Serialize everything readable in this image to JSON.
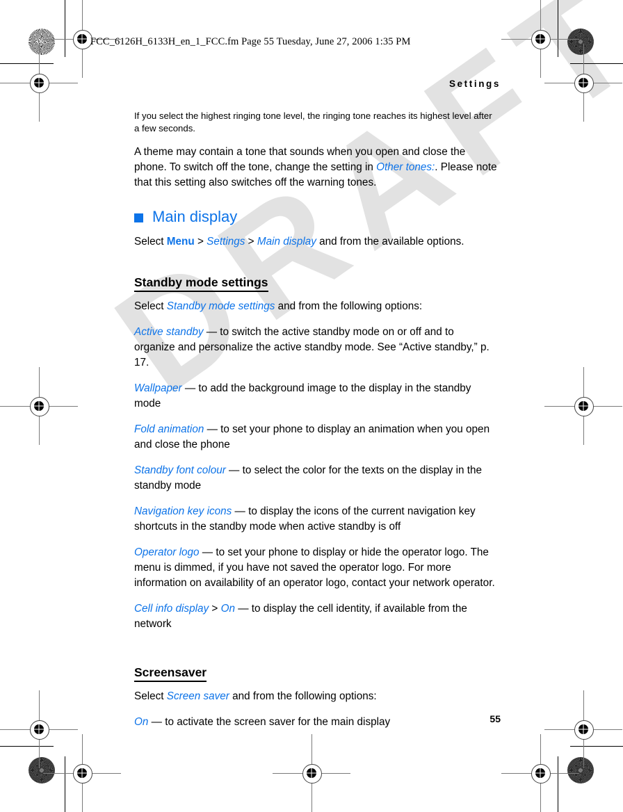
{
  "film_header": "FCC_6126H_6133H_en_1_FCC.fm  Page 55  Tuesday, June 27, 2006  1:35 PM",
  "running_head": "Settings",
  "watermark": "DRAFT",
  "folio": "55",
  "colors": {
    "accent_blue": "#0d73e8",
    "text_black": "#000000",
    "watermark_gray": "#e2e2e2",
    "page_background": "#ffffff"
  },
  "content": {
    "note": "If you select the highest ringing tone level, the ringing tone reaches its highest level after a few seconds.",
    "intro_para": {
      "before": "A theme may contain a tone that sounds when you open and close the phone. To switch off the tone, change the setting in ",
      "ui": "Other tones:",
      "after": ". Please note that this setting also switches off the warning tones."
    },
    "main_display": {
      "heading": "Main display",
      "select_line": {
        "select": "Select ",
        "menu": "Menu",
        "sep1": " > ",
        "settings": "Settings",
        "sep2": " > ",
        "target": "Main display",
        "after": " and from the available options."
      }
    },
    "standby": {
      "heading": "Standby mode settings",
      "select_line": {
        "select": "Select ",
        "ui": "Standby mode settings",
        "after": " and from the following options:"
      },
      "options": [
        {
          "name": "Active standby",
          "dash": " — ",
          "desc": "to switch the active standby mode on or off and to organize and personalize the active standby mode. See “Active standby,” p. 17."
        },
        {
          "name": "Wallpaper",
          "dash": " — ",
          "desc": "to add the background image to the display in the standby mode"
        },
        {
          "name": "Fold animation",
          "dash": " — ",
          "desc": "to set your phone to display an animation when you open and close the phone"
        },
        {
          "name": "Standby font colour",
          "dash": " — ",
          "desc": "to select the color for the texts on the display in the standby mode"
        },
        {
          "name": "Navigation key icons",
          "dash": " — ",
          "desc": "to display the icons of the current navigation key shortcuts in the standby mode when active standby is off"
        },
        {
          "name": "Operator logo",
          "dash": " — ",
          "desc": "to set your phone to display or hide the operator logo. The menu is dimmed, if you have not saved the operator logo. For more information on availability of an operator logo, contact your network operator."
        }
      ],
      "cell_info": {
        "name": "Cell info display",
        "sep": " > ",
        "value": "On",
        "dash": " — ",
        "desc": "to display the cell identity, if available from the network"
      }
    },
    "screensaver": {
      "heading": "Screensaver",
      "select_line": {
        "select": "Select ",
        "ui": "Screen saver",
        "after": " and from the following options:"
      },
      "options": [
        {
          "name": "On",
          "dash": " — ",
          "desc": "to activate the screen saver for the main display"
        }
      ]
    }
  }
}
